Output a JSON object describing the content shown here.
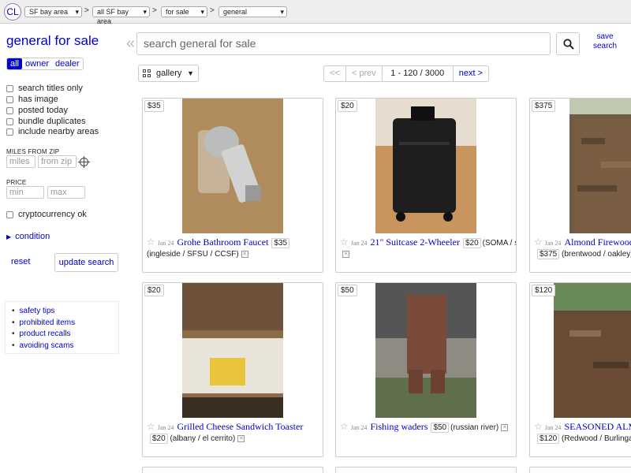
{
  "topbar": {
    "logo": "CL",
    "crumbs": [
      "SF bay area",
      "all SF bay area",
      "for sale",
      "general"
    ]
  },
  "sidebar": {
    "title": "general for sale",
    "seller_tabs": [
      "all",
      "owner",
      "dealer"
    ],
    "filters": [
      "search titles only",
      "has image",
      "posted today",
      "bundle duplicates",
      "include nearby areas"
    ],
    "miles_label": "MILES FROM ZIP",
    "miles_placeholder": "miles",
    "zip_placeholder": "from zip",
    "price_label": "PRICE",
    "min_placeholder": "min",
    "max_placeholder": "max",
    "crypto": "cryptocurrency ok",
    "condition": "condition",
    "reset": "reset",
    "update": "update search",
    "safety_links": [
      "safety tips",
      "prohibited items",
      "product recalls",
      "avoiding scams"
    ]
  },
  "search": {
    "placeholder": "search general for sale",
    "save_label_1": "save",
    "save_label_2": "search"
  },
  "view": {
    "mode": "gallery",
    "pager": {
      "first": "<<",
      "prev": "< prev",
      "range": "1 - 120 / 3000",
      "next": "next >"
    }
  },
  "listings": [
    {
      "price": "$35",
      "date": "Jan 24",
      "title": "Grohe Bathroom Faucet",
      "location": "(ingleside / SFSU / CCSF)",
      "photo_color": "#a8845a"
    },
    {
      "price": "$20",
      "date": "Jan 24",
      "title": "21\" Suitcase 2-Wheeler",
      "location": "(SOMA / south beach)",
      "photo_color": "#c9955e"
    },
    {
      "price": "$375",
      "date": "Jan 24",
      "title": "Almond Firewood",
      "location": "(brentwood / oakley)",
      "photo_color": "#6f5a45"
    },
    {
      "price": "$20",
      "date": "Jan 24",
      "title": "Grilled Cheese Sandwich Toaster",
      "location": "(albany / el cerrito)",
      "photo_color": "#8a6b4a"
    },
    {
      "price": "$50",
      "date": "Jan 24",
      "title": "Fishing waders",
      "location": "(russian river)",
      "photo_color": "#8f8a82"
    },
    {
      "price": "$120",
      "date": "Jan 24",
      "title": "SEASONED ALMOND FIREWOOD",
      "location": "(Redwood / Burlingame)",
      "photo_color": "#5e4a38"
    }
  ]
}
